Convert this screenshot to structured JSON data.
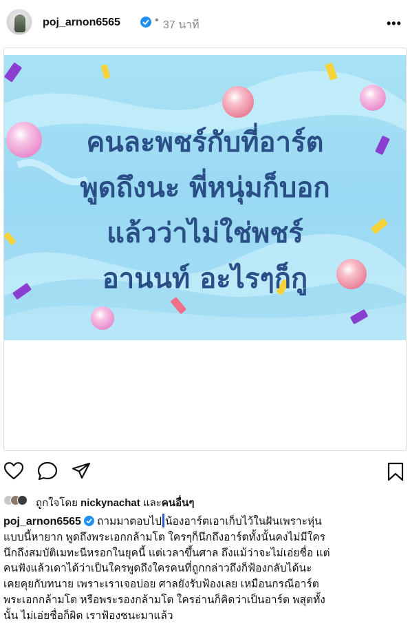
{
  "post": {
    "username": "poj_arnon6565",
    "separator": "•",
    "time_ago": "37 นาที",
    "more_label": "•••"
  },
  "image_text": {
    "line1": "คนละพชร์กับที่อาร์ต",
    "line2": "พูดถึงนะ พี่หนุ่มก็บอก",
    "line3": "แล้วว่าไม่ใช่พชร์",
    "line4": "อานนท์ อะไรๆก็กู"
  },
  "likes": {
    "prefix": "ถูกใจโดย",
    "user": "nickynachat",
    "conjunction": "และ",
    "others": "คนอื่นๆ"
  },
  "caption": {
    "username": "poj_arnon6565",
    "line1_a": "ถามมาตอบไป",
    "line1_b": "น้องอาร์ตเอาเก็บไว้ในฝันเพราะหุ่น",
    "line2": "แบบนี้หายาก พูดถึงพระเอกกล้ามโต ใครๆก็นึกถึงอาร์ตทั้งนั้นคงไม่มีใคร",
    "line3": "นึกถึงสมบัติเมทะนีหรอกในยุคนี้ แต่เวลาขึ้นศาล ถึงแม้ว่าจะไม่เอ่ยชื่อ แต่",
    "line4": "คนฟังแล้วเดาได้ว่าเป็นใครพูดถึงใครคนที่ถูกกล่าวถึงก็ฟ้องกลับได้นะ",
    "line5": "เคยคุยกับทนาย เพราะเราเจอบ่อย ศาลยังรับฟ้องเลย เหมือนกรณีอาร์ต",
    "line6": "พระเอกกล้ามโต หรือพระรองกล้ามโต ใครอ่านก็คิดว่าเป็นอาร์ต พสุตทั้ง",
    "line7": "นั้น ไม่เอ่ยชื่อก็ผิด เราฟ้องชนะมาแล้ว"
  },
  "icons": [
    "heart-icon",
    "comment-icon",
    "share-icon",
    "bookmark-icon",
    "verified-icon"
  ],
  "colors": {
    "verified": "#1f8ff5",
    "image_text": "#2a4f87",
    "image_background": "#a9e2f5",
    "secondary_text": "#888888"
  }
}
